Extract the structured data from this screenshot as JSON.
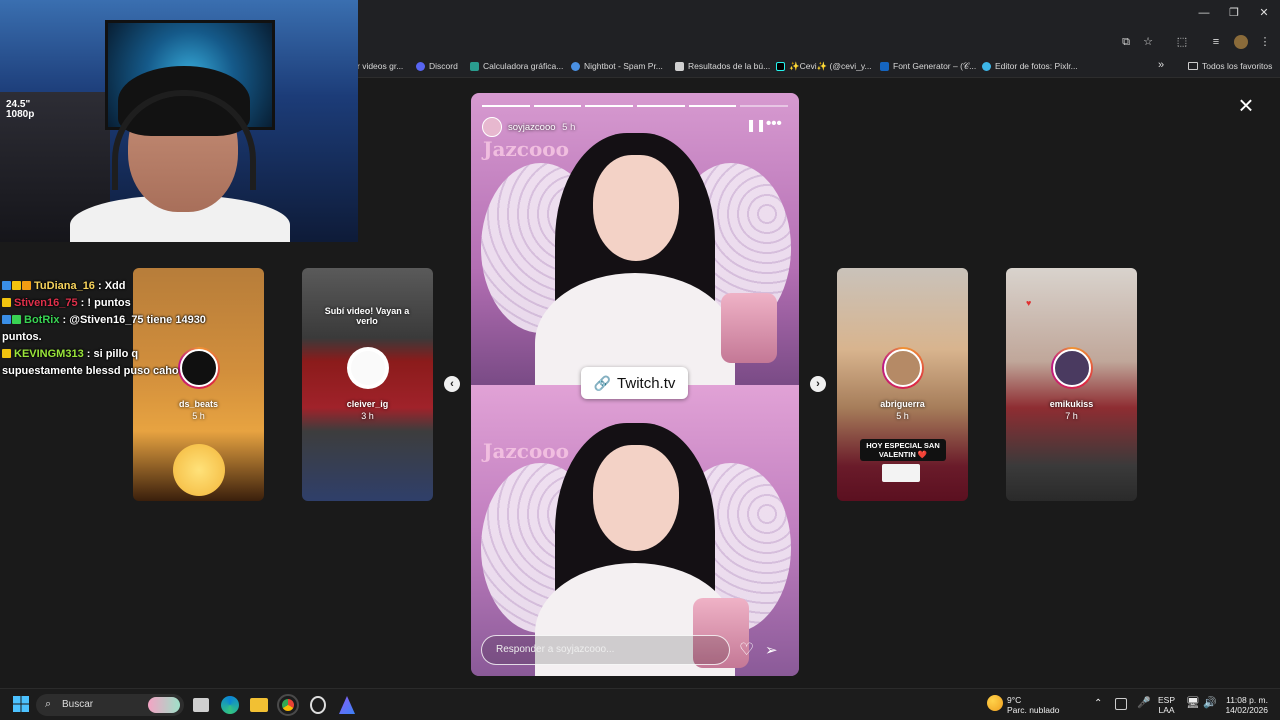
{
  "bookmarks": {
    "items": [
      {
        "label": "r videos gr...",
        "color": "#8ab4f8"
      },
      {
        "label": "Discord",
        "color": "#5865F2"
      },
      {
        "label": "Calculadora gráfica...",
        "color": "#2a9d8f"
      },
      {
        "label": "Nightbot - Spam Pr...",
        "color": "#4a90e2"
      },
      {
        "label": "Resultados de la bú...",
        "color": "#d0d0d0"
      },
      {
        "label": "✨Cevi✨ (@cevi_y...",
        "color": "#000000"
      },
      {
        "label": "Font Generator – (𝒞...",
        "color": "#1565c0"
      },
      {
        "label": "Editor de fotos: Pixlr...",
        "color": "#3db6e8"
      }
    ],
    "overflow_icon": "chevron-double-right",
    "all_label": "Todos los favoritos"
  },
  "webcam": {
    "resolution_text": "24.5\"\n1080p"
  },
  "chat": [
    {
      "user": "TuDiana_16",
      "user_color": "#f7d35c",
      "badges": [
        "#3a8ee6",
        "#f1c40f",
        "#f39c12"
      ],
      "message": " : Xdd"
    },
    {
      "user": "Stiven16_75",
      "user_color": "#e0304b",
      "badges": [
        "#f1c40f"
      ],
      "message": " : ! puntos"
    },
    {
      "user": "BotRix",
      "user_color": "#39d353",
      "badges": [
        "#3a8ee6",
        "#39d353"
      ],
      "message": " : @Stiven16_75 tiene 14930 puntos."
    },
    {
      "user": "KEVINGM313",
      "user_color": "#9ae53b",
      "badges": [
        "#f1c40f"
      ],
      "message": " : si pillo q supuestamente blessd puso caho"
    }
  ],
  "stories": {
    "left": [
      {
        "user": "ds_beats",
        "time": "5 h"
      },
      {
        "user": "cleiver_ig",
        "time": "3 h",
        "overlay_text": "Subí video! Vayan a verlo"
      }
    ],
    "right": [
      {
        "user": "abriguerra",
        "time": "5 h",
        "sticker": "HOY ESPECIAL SAN VALENTIN ❤️"
      },
      {
        "user": "emikukiss",
        "time": "7 h"
      }
    ],
    "main": {
      "user": "soyjazcooo",
      "time": "5 h",
      "link_label": "Twitch.tv",
      "reply_placeholder": "Responder a soyjazcooo...",
      "progress_segments": 6,
      "progress_current": 5
    }
  },
  "taskbar": {
    "search_label": "Buscar",
    "weather_temp": "9°C",
    "weather_desc": "Parc. nublado",
    "lang_1": "ESP",
    "lang_2": "LAA",
    "time": "11:08 p. m.",
    "date": "14/02/2026"
  }
}
